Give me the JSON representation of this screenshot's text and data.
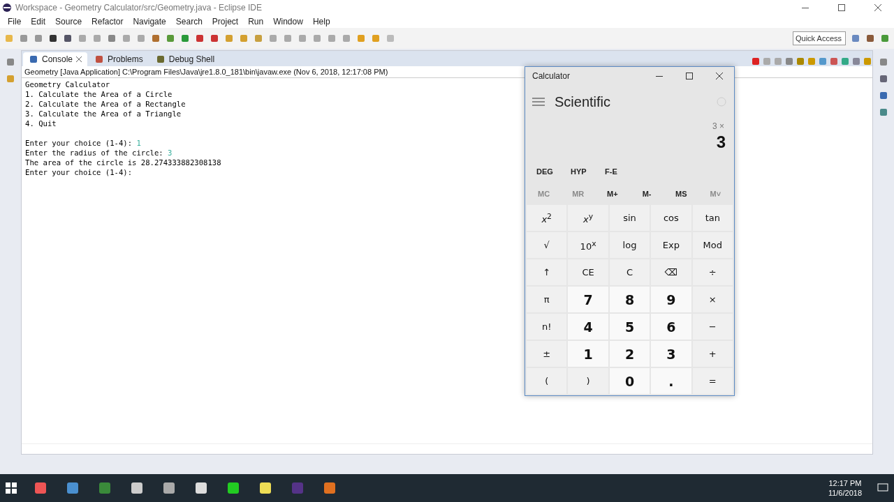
{
  "window": {
    "title": "Workspace - Geometry Calculator/src/Geometry.java - Eclipse IDE"
  },
  "menu": [
    "File",
    "Edit",
    "Source",
    "Refactor",
    "Navigate",
    "Search",
    "Project",
    "Run",
    "Window",
    "Help"
  ],
  "quick_access": {
    "placeholder": "Quick Access"
  },
  "tabs": [
    {
      "label": "Console",
      "selected": true,
      "closable": true
    },
    {
      "label": "Problems",
      "selected": false,
      "closable": false
    },
    {
      "label": "Debug Shell",
      "selected": false,
      "closable": false
    }
  ],
  "console": {
    "header": "Geometry [Java Application] C:\\Program Files\\Java\\jre1.8.0_181\\bin\\javaw.exe (Nov 6, 2018, 12:17:08 PM)",
    "blocks": [
      {
        "lines": [
          {
            "text": "Geometry Calculator"
          },
          {
            "text": "1. Calculate the Area of a Circle"
          },
          {
            "text": "2. Calculate the Area of a Rectangle"
          },
          {
            "text": "3. Calculate the Area of a Triangle"
          },
          {
            "text": "4. Quit"
          }
        ]
      },
      {
        "lines": [
          {
            "text": "Enter your choice (1-4): ",
            "input": "1"
          },
          {
            "text": "Enter the radius of the circle: ",
            "input": "3"
          },
          {
            "text": "The area of the circle is 28.274333882308138"
          },
          {
            "text": "Enter your choice (1-4):"
          }
        ]
      }
    ]
  },
  "calculator": {
    "title": "Calculator",
    "mode": "Scientific",
    "expression": "3 ×",
    "display": "3",
    "modes": [
      "DEG",
      "HYP",
      "F-E"
    ],
    "memory": [
      {
        "label": "MC",
        "disabled": true
      },
      {
        "label": "MR",
        "disabled": true
      },
      {
        "label": "M+",
        "disabled": false
      },
      {
        "label": "M-",
        "disabled": false
      },
      {
        "label": "MS",
        "disabled": false
      },
      {
        "label": "M˅",
        "disabled": true
      }
    ],
    "keys": [
      {
        "label": "*x*$^{2}$",
        "kind": "function"
      },
      {
        "label": "*x*$^{y}$",
        "kind": "function"
      },
      {
        "label": "sin",
        "kind": "function"
      },
      {
        "label": "cos",
        "kind": "function"
      },
      {
        "label": "tan",
        "kind": "function"
      },
      {
        "label": "√",
        "kind": "function"
      },
      {
        "label": "10$^{x}$",
        "kind": "function"
      },
      {
        "label": "log",
        "kind": "function"
      },
      {
        "label": "Exp",
        "kind": "function"
      },
      {
        "label": "Mod",
        "kind": "function"
      },
      {
        "label": "↑",
        "kind": "function"
      },
      {
        "label": "CE",
        "kind": "function"
      },
      {
        "label": "C",
        "kind": "function"
      },
      {
        "label": "⌫",
        "kind": "function"
      },
      {
        "label": "÷",
        "kind": "function"
      },
      {
        "label": "π",
        "kind": "function"
      },
      {
        "label": "7",
        "kind": "digit"
      },
      {
        "label": "8",
        "kind": "digit"
      },
      {
        "label": "9",
        "kind": "digit"
      },
      {
        "label": "×",
        "kind": "function"
      },
      {
        "label": "n!",
        "kind": "function"
      },
      {
        "label": "4",
        "kind": "digit"
      },
      {
        "label": "5",
        "kind": "digit"
      },
      {
        "label": "6",
        "kind": "digit"
      },
      {
        "label": "−",
        "kind": "function"
      },
      {
        "label": "±",
        "kind": "function"
      },
      {
        "label": "1",
        "kind": "digit"
      },
      {
        "label": "2",
        "kind": "digit"
      },
      {
        "label": "3",
        "kind": "digit"
      },
      {
        "label": "+",
        "kind": "function"
      },
      {
        "label": "(",
        "kind": "function"
      },
      {
        "label": ")",
        "kind": "function"
      },
      {
        "label": "0",
        "kind": "digit"
      },
      {
        "label": ".",
        "kind": "digit"
      },
      {
        "label": "=",
        "kind": "function"
      }
    ]
  },
  "taskbar": {
    "time": "12:17 PM",
    "date": "11/6/2018"
  }
}
